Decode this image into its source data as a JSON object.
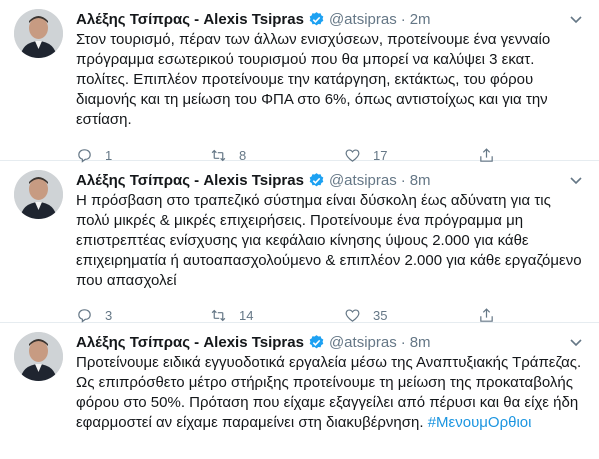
{
  "tweets": [
    {
      "author": "Αλέξης Τσίπρας - Alexis Tsipras",
      "handle": "@atsipras",
      "separator": "·",
      "time": "2m",
      "text": "Στον τουρισμό, πέραν των άλλων ενισχύσεων, προτείνουμε ένα γενναίο πρόγραμμα εσωτερικού τουρισμού που θα μπορεί να καλύψει 3 εκατ. πολίτες. Επιπλέον προτείνουμε την κατάργηση, εκτάκτως, του φόρου διαμονής και τη μείωση του ΦΠΑ στο 6%, όπως αντιστοίχως και για την εστίαση.",
      "hashtag": "",
      "replies": "1",
      "retweets": "8",
      "likes": "17"
    },
    {
      "author": "Αλέξης Τσίπρας - Alexis Tsipras",
      "handle": "@atsipras",
      "separator": "·",
      "time": "8m",
      "text": "Η πρόσβαση στο τραπεζικό σύστημα είναι δύσκολη έως αδύνατη για τις πολύ μικρές & μικρές επιχειρήσεις. Προτείνουμε ένα πρόγραμμα μη επιστρεπτέας ενίσχυσης για κεφάλαιο κίνησης ύψους 2.000 για κάθε επιχειρηματία ή αυτοαπασχολούμενο & επιπλέον 2.000 για κάθε εργαζόμενο που απασχολεί",
      "hashtag": "",
      "replies": "3",
      "retweets": "14",
      "likes": "35"
    },
    {
      "author": "Αλέξης Τσίπρας - Alexis Tsipras",
      "handle": "@atsipras",
      "separator": "·",
      "time": "8m",
      "text": "Προτείνουμε ειδικά εγγυοδοτικά εργαλεία μέσω της Αναπτυξιακής Τράπεζας. Ως επιπρόσθετο μέτρο στήριξης προτείνουμε τη μείωση της προκαταβολής φόρου στο 50%. Πρόταση που είχαμε εξαγγείλει από πέρυσι και θα είχε ήδη εφαρμοστεί αν είχαμε παραμείνει στη διακυβέρνηση. ",
      "hashtag": "#ΜενουμΟρθιοι",
      "replies": "",
      "retweets": "",
      "likes": ""
    }
  ],
  "colors": {
    "accent": "#1b95e0",
    "verified": "#1da1f2",
    "muted": "#657786",
    "divider": "#e6ecf0"
  },
  "icons": [
    "avatar",
    "verified-badge-icon",
    "chevron-down-icon",
    "reply-icon",
    "retweet-icon",
    "like-icon",
    "share-icon"
  ]
}
